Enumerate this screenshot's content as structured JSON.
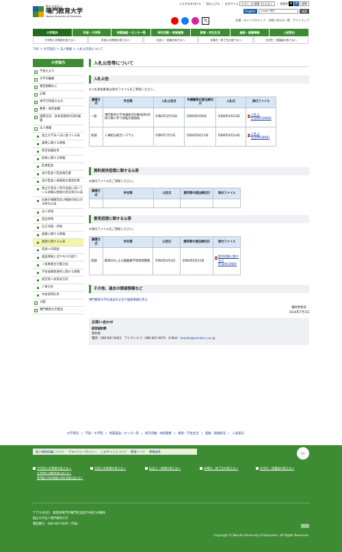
{
  "header": {
    "logo_sub": "国立大学法人",
    "logo_name": "鳴門教育大学",
    "logo_en": "Naruto University of Education",
    "util": [
      "ふりがなを付ける",
      "読み上げる",
      "文字サイズ",
      "小さく",
      "標準",
      "大きく",
      "背景色",
      "黒",
      "青",
      "標準"
    ],
    "english": "English",
    "search_placeholder": "Google 提供",
    "search_btn": "検索",
    "links": [
      "交通・キャンパスマップ",
      "お問い合わせ一覧",
      "サイトマップ"
    ]
  },
  "gnav": [
    "大学案内",
    "学部・大学院",
    "附属施設・センター等",
    "研究活動・地域連携",
    "教育・学生生活",
    "進路・就職情報",
    "入試案内"
  ],
  "gnav2": [
    "大学院入学希望の皆さまへ",
    "学部入学希望の皆さまへ",
    "社会人・地域の皆さまへ",
    "卒業生・修了生の皆さまへ",
    "在学生・保護者の皆さまへ"
  ],
  "breadcrumb": "TOP ＞ 大学案内 ＞ 法人情報 ＞ 入札公告等について",
  "sidebar": {
    "title": "大学案内",
    "items": [
      {
        "label": "学長だより",
        "sub": false
      },
      {
        "label": "大学の概要",
        "sub": false
      },
      {
        "label": "運営組織など",
        "sub": false
      },
      {
        "label": "広報",
        "sub": false
      },
      {
        "label": "本学が目指すもの",
        "sub": false
      },
      {
        "label": "教育・研究組織",
        "sub": false
      },
      {
        "label": "国際交流・日本型教育の海外展開",
        "sub": false
      },
      {
        "label": "法人情報",
        "sub": false,
        "minus": true
      },
      {
        "label": "国立大学法人法に基づく公表",
        "sub": true
      },
      {
        "label": "業務に関する情報",
        "sub": true
      },
      {
        "label": "経営協議会等",
        "sub": true
      },
      {
        "label": "財務に関する情報",
        "sub": true
      },
      {
        "label": "監事監査",
        "sub": true
      },
      {
        "label": "会計監査人監査報告書",
        "sub": true
      },
      {
        "label": "会計監査人候補者の選定結果",
        "sub": true
      },
      {
        "label": "独立行政法人等の役員に就いている退職公務員の状況等の公表",
        "sub": true
      },
      {
        "label": "役員の報酬等及び職員の給与の水準の公表",
        "sub": true
      },
      {
        "label": "法人評価",
        "sub": true
      },
      {
        "label": "認証評価",
        "sub": true
      },
      {
        "label": "自己点検・評価",
        "sub": true
      },
      {
        "label": "組織に関する情報",
        "sub": true
      },
      {
        "label": "調達に関する公表",
        "sub": true,
        "current": true
      },
      {
        "label": "環境への取組",
        "sub": true
      },
      {
        "label": "施設情報と北や木々の紹介",
        "sub": true
      },
      {
        "label": "一般事業主行動計画",
        "sub": true
      },
      {
        "label": "学長候補者選考に関する情報",
        "sub": true
      },
      {
        "label": "経営等人材育成方針",
        "sub": true
      },
      {
        "label": "人事方針",
        "sub": true
      },
      {
        "label": "中途採用比率",
        "sub": true
      },
      {
        "label": "公開",
        "sub": false
      },
      {
        "label": "鳴門教育大学基金",
        "sub": false
      }
    ]
  },
  "main": {
    "title": "入札公告等について",
    "s1": {
      "title": "入札公告",
      "note": "※入札参加者様は添付ファイルをご参照ください。",
      "headers": [
        "調達方式",
        "件名等",
        "入札公告日",
        "申請書等の提出締切日",
        "入札日",
        "添付ファイル"
      ],
      "rows": [
        [
          "一般",
          "鳴門教育大学共通研究D棟(仮称)改修工事に伴う移転作業請負",
          "令和6年3月19日",
          "令和6年4月8日",
          "令和6年4月24日",
          "入札公告.pdf[536KB]"
        ],
        [
          "政調",
          "入事給与統合システム",
          "令和6年7月1日",
          "令和6年8月23日",
          "令和6年9月24日",
          "入札公告.pdf[68KB]"
        ]
      ]
    },
    "s2": {
      "title": "資料提供招請に関する公表",
      "note": "※添付ファイルをご参照ください。",
      "headers": [
        "調達方式",
        "件名等",
        "公告日",
        "資料等の提出締切日",
        "添付ファイル"
      ]
    },
    "s3": {
      "title": "意見招請に関する公表",
      "note": "※添付ファイルをご参照ください。",
      "headers": [
        "調達方式",
        "件名等",
        "公告日",
        "資料等の提出締切日",
        "添付ファイル"
      ],
      "rows": [
        [
          "政調",
          "教育DXによる議義練学修環境整備",
          "令和6年6月3日",
          "令和6年6月25日",
          "意見招請に関する公示.pdf[39KB]"
        ]
      ]
    },
    "s4": {
      "title": "その他、過去の調達情報など",
      "link": "鳴門教育大学の過去の公告や調達情報を見る"
    },
    "update_label": "最終更新日：",
    "update_date": "2024年7月1日",
    "contact": {
      "title": "お問い合わせ",
      "dept": "経営総財課",
      "sub": "契約係",
      "phone": "電話：088-687-6063　ファクシミリ：088-687-6079　E-Mail：",
      "email": "keiyaku@naruto-u.ac.jp"
    }
  },
  "footer_links": [
    "大学案内",
    "学部・大学院",
    "附属施設・センター等",
    "研究活動・地域連携",
    "教育・学生生活",
    "進路・就職状況",
    "入試案内"
  ],
  "footer": {
    "top": [
      "個人情報保護について",
      "プライバシーポリシー",
      "このサイトについて",
      "関連リンク",
      "教職員専"
    ],
    "badge": "認定",
    "cols": [
      {
        "label": "大学院入学希望の皆さまへ",
        "subs": [
          "大学院修士課程希望の皆さまへ",
          "専門職大学院(教職大学院)希望の皆さまへ"
        ]
      },
      {
        "label": "学部入学希望の皆さまへ",
        "subs": []
      },
      {
        "label": "社会人・地域の皆さまへ",
        "subs": []
      },
      {
        "label": "卒業生・修了生の皆さまへ",
        "subs": []
      },
      {
        "label": "在学生・保護者の皆さまへ",
        "subs": []
      }
    ],
    "address": [
      "〒772-8502　徳島県鳴門市鳴門町高島字中島748番地",
      "国立大学法人鳴門教育大学",
      "電話番号：088-687-6000（代表）"
    ],
    "copyright": "Copyright © Naruto University of Education. All Rights Reserved."
  },
  "colors": {
    "green": "#3d8c33",
    "dark_green": "#246b1c",
    "table_head": "#d9e6f5"
  }
}
